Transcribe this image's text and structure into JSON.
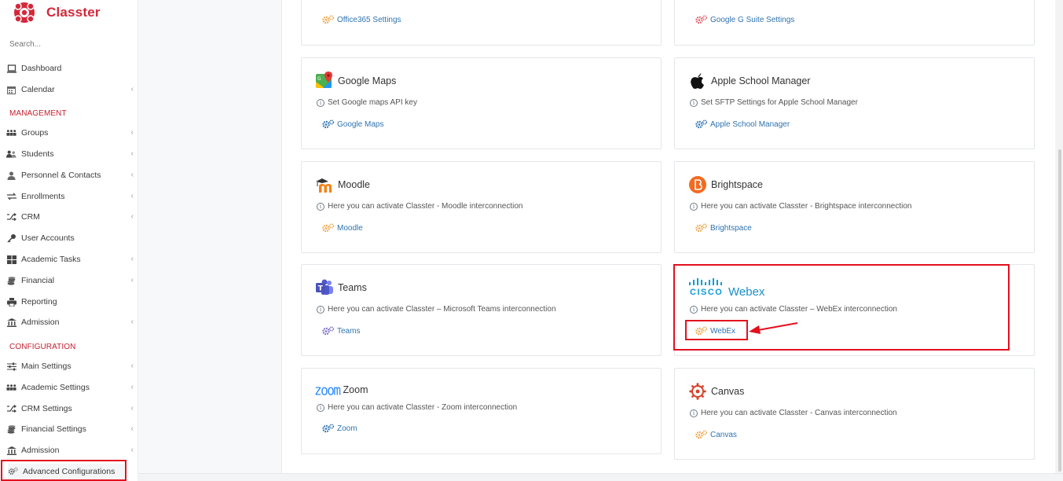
{
  "brand": {
    "name": "Classter",
    "color": "#d3283a"
  },
  "search": {
    "placeholder": "Search..."
  },
  "nav": {
    "top": [
      {
        "label": "Dashboard",
        "icon": "laptop-icon",
        "chevron": false
      },
      {
        "label": "Calendar",
        "icon": "calendar-icon",
        "chevron": true
      }
    ],
    "management_header": "MANAGEMENT",
    "management": [
      {
        "label": "Groups",
        "icon": "groups-icon",
        "chevron": true
      },
      {
        "label": "Students",
        "icon": "students-icon",
        "chevron": true
      },
      {
        "label": "Personnel & Contacts",
        "icon": "person-icon",
        "chevron": true
      },
      {
        "label": "Enrollments",
        "icon": "exchange-icon",
        "chevron": true
      },
      {
        "label": "CRM",
        "icon": "random-icon",
        "chevron": true
      },
      {
        "label": "User Accounts",
        "icon": "key-icon",
        "chevron": false
      },
      {
        "label": "Academic Tasks",
        "icon": "grid-icon",
        "chevron": true
      },
      {
        "label": "Financial",
        "icon": "coins-icon",
        "chevron": true
      },
      {
        "label": "Reporting",
        "icon": "printer-icon",
        "chevron": false
      },
      {
        "label": "Admission",
        "icon": "institution-icon",
        "chevron": true
      }
    ],
    "configuration_header": "CONFIGURATION",
    "configuration": [
      {
        "label": "Main Settings",
        "icon": "sliders-icon",
        "chevron": true
      },
      {
        "label": "Academic Settings",
        "icon": "groups-icon",
        "chevron": true
      },
      {
        "label": "CRM Settings",
        "icon": "random-icon",
        "chevron": true
      },
      {
        "label": "Financial Settings",
        "icon": "coins-icon",
        "chevron": true
      },
      {
        "label": "Admission",
        "icon": "institution-icon",
        "chevron": true
      },
      {
        "label": "Advanced Configurations",
        "icon": "gears-icon",
        "chevron": false
      }
    ]
  },
  "cards": [
    {
      "title": "",
      "desc": "",
      "link": "Office365 Settings",
      "logo": "office365",
      "gear_color": "#f0a64a"
    },
    {
      "title": "",
      "desc": "",
      "link": "Google G Suite Settings",
      "logo": "gsuite",
      "gear_color": "#e35d6a"
    },
    {
      "title": "Google Maps",
      "desc": "Set Google maps API key",
      "link": "Google Maps",
      "logo": "google-maps-logo",
      "gear_color": "#2f73b0"
    },
    {
      "title": "Apple School Manager",
      "desc": "Set SFTP Settings for Apple School Manager",
      "link": "Apple School Manager",
      "logo": "apple-logo",
      "gear_color": "#2f73b0"
    },
    {
      "title": "Moodle",
      "desc": "Here you can activate Classter - Moodle interconnection",
      "link": "Moodle",
      "logo": "moodle-logo",
      "gear_color": "#f0a64a"
    },
    {
      "title": "Brightspace",
      "desc": "Here you can activate Classter - Brightspace interconnection",
      "link": "Brightspace",
      "logo": "brightspace-logo",
      "gear_color": "#f0a64a"
    },
    {
      "title": "Teams",
      "desc": "Here you can activate Classter – Microsoft Teams interconnection",
      "link": "Teams",
      "logo": "teams-logo",
      "gear_color": "#7b6bc6"
    },
    {
      "title": "",
      "desc": "Here you can activate Classter – WebEx interconnection",
      "link": "WebEx",
      "logo": "cisco-webex-logo",
      "gear_color": "#f0a64a"
    },
    {
      "title": "Zoom",
      "desc": "Here you can activate Classter - Zoom interconnection",
      "link": "Zoom",
      "logo": "zoom-logo",
      "gear_color": "#2f73b0"
    },
    {
      "title": "Canvas",
      "desc": "Here you can activate Classter - Canvas interconnection",
      "link": "Canvas",
      "logo": "canvas-logo",
      "gear_color": "#f0a64a"
    }
  ],
  "webex_logo": {
    "cisco": "CISCO",
    "webex": "Webex"
  },
  "zoom_logo_text": "zoom",
  "highlight_color": "#e3101e"
}
